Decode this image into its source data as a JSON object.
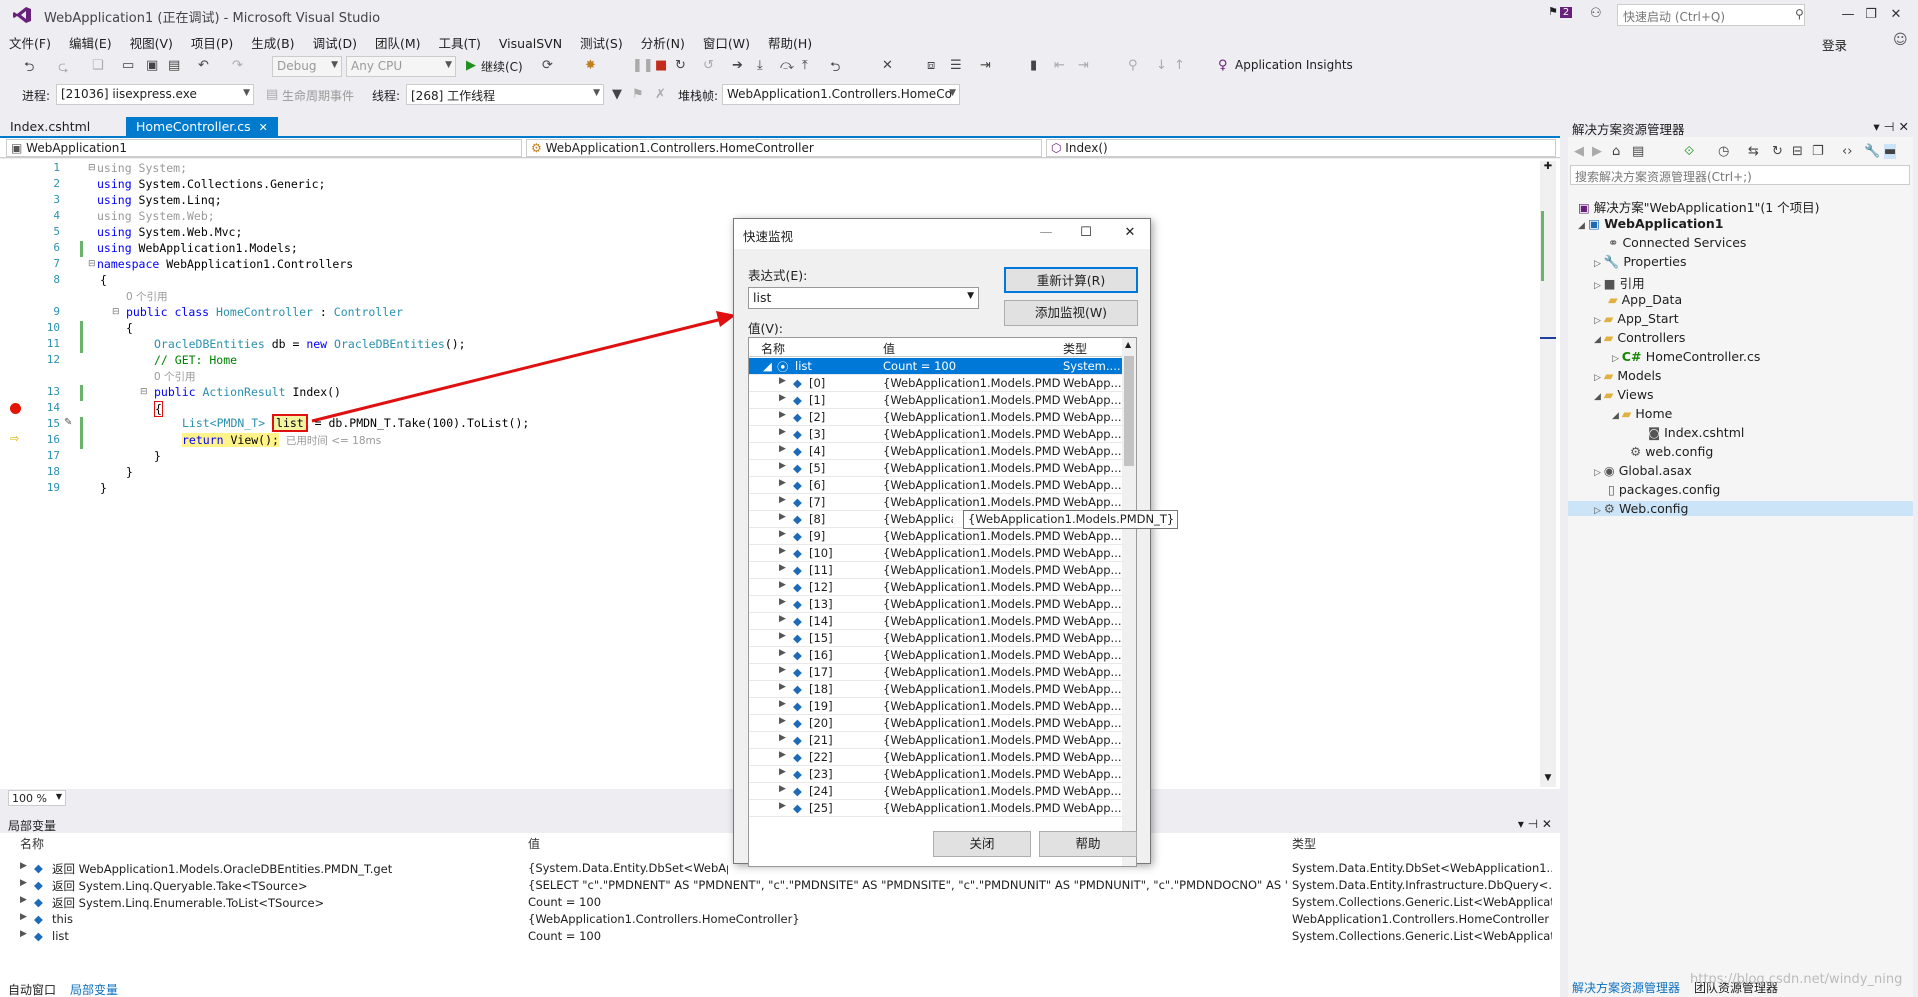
{
  "window": {
    "title": "WebApplication1 (正在调试) - Microsoft Visual Studio",
    "notification_count": "2",
    "quick_launch_placeholder": "快速启动 (Ctrl+Q)",
    "signin": "登录"
  },
  "menu": [
    "文件(F)",
    "编辑(E)",
    "视图(V)",
    "项目(P)",
    "生成(B)",
    "调试(D)",
    "团队(M)",
    "工具(T)",
    "VisualSVN",
    "测试(S)",
    "分析(N)",
    "窗口(W)",
    "帮助(H)"
  ],
  "toolbar": {
    "config": "Debug",
    "platform": "Any CPU",
    "continue_label": "继续(C)",
    "app_insights": "Application Insights"
  },
  "debug_toolbar": {
    "process_label": "进程:",
    "process": "[21036] iisexpress.exe",
    "lifecycle": "生命周期事件",
    "thread_label": "线程:",
    "thread": "[268] 工作线程",
    "stack_label": "堆栈帧:",
    "stack": "WebApplication1.Controllers.HomeCo"
  },
  "tabs": [
    {
      "label": "Index.cshtml"
    },
    {
      "label": "HomeController.cs"
    }
  ],
  "editor_nav": {
    "project": "WebApplication1",
    "class": "WebApplication1.Controllers.HomeController",
    "member": "Index()"
  },
  "code": {
    "line_numbers": [
      "1",
      "2",
      "3",
      "4",
      "5",
      "6",
      "7",
      "8",
      "9",
      "10",
      "11",
      "12",
      "13",
      "14",
      "15",
      "16",
      "17",
      "18",
      "19"
    ],
    "l1_kw": "using",
    "l1_rest": " System;",
    "l2_kw": "using",
    "l2_rest": " System.Collections.Generic;",
    "l3_kw": "using",
    "l3_rest": " System.Linq;",
    "l4_kw": "using",
    "l4_rest": " System.Web;",
    "l5_kw": "using",
    "l5_rest": " System.Web.Mvc;",
    "l6_kw": "using",
    "l6_rest": " WebApplication1.Models;",
    "l7_kw": "namespace",
    "l7_rest": " WebApplication1.Controllers",
    "l8": "{",
    "ref1": "0 个引用",
    "l9_kw1": "public",
    "l9_kw2": "class",
    "l9_type": "HomeController",
    "l9_colon": " : ",
    "l9_base": "Controller",
    "l10": "{",
    "l11_type": "OracleDBEntities",
    "l11_mid": " db = ",
    "l11_kw": "new",
    "l11_type2": "OracleDBEntities",
    "l11_end": "();",
    "l12": "// GET: Home",
    "ref2": "0 个引用",
    "l13_kw": "public",
    "l13_type": "ActionResult",
    "l13_rest": " Index()",
    "l14": "{",
    "l15_type": "List",
    "l15_gen": "<PMDN_T>",
    "l15_var": "list",
    "l15_rest": " = db.PMDN_T.Take(100).ToList();",
    "l16_kw": "return",
    "l16_call": " View();",
    "l16_elapsed": "已用时间 <= 18ms",
    "l17": "}",
    "l18": "}",
    "l19": "}"
  },
  "zoom": "100 %",
  "locals": {
    "title": "局部变量",
    "col_name": "名称",
    "col_value": "值",
    "col_type": "类型",
    "rows": [
      {
        "name": "返回 WebApplication1.Models.OracleDBEntities.PMDN_T.get",
        "value": "{System.Data.Entity.DbSet<WebApplica",
        "type": "System.Data.Entity.DbSet<WebApplication1...."
      },
      {
        "name": "返回 System.Linq.Queryable.Take<TSource>",
        "value": "{SELECT \"c\".\"PMDNENT\" AS \"PMDNENT\", \"c\".\"PMDNSITE\" AS \"PMDNSITE\", \"c\".\"PMDNUNIT\" AS \"PMDNUNIT\", \"c\".\"PMDNDOCNO\" AS \"PMD...",
        "type": "System.Data.Entity.Infrastructure.DbQuery<..."
      },
      {
        "name": "返回 System.Linq.Enumerable.ToList<TSource>",
        "value": "Count = 100",
        "type": "System.Collections.Generic.List<WebApplicat..."
      },
      {
        "name": "this",
        "value": "{WebApplication1.Controllers.HomeController}",
        "type": "WebApplication1.Controllers.HomeController"
      },
      {
        "name": "list",
        "value": "Count = 100",
        "type": "System.Collections.Generic.List<WebApplicat..."
      }
    ],
    "bottom_tab1": "自动窗口",
    "bottom_tab2": "局部变量"
  },
  "solution": {
    "title": "解决方案资源管理器",
    "search_placeholder": "搜索解决方案资源管理器(Ctrl+;)",
    "items": [
      {
        "label": "解决方案\"WebApplication1\"(1 个项目)"
      },
      {
        "label": "WebApplication1"
      },
      {
        "label": "Connected Services"
      },
      {
        "label": "Properties"
      },
      {
        "label": "引用"
      },
      {
        "label": "App_Data"
      },
      {
        "label": "App_Start"
      },
      {
        "label": "Controllers"
      },
      {
        "label": "HomeController.cs"
      },
      {
        "label": "Models"
      },
      {
        "label": "Views"
      },
      {
        "label": "Home"
      },
      {
        "label": "Index.cshtml"
      },
      {
        "label": "web.config"
      },
      {
        "label": "Global.asax"
      },
      {
        "label": "packages.config"
      },
      {
        "label": "Web.config"
      }
    ],
    "bottom_tab1": "解决方案资源管理器",
    "bottom_tab2": "团队资源管理器"
  },
  "quickwatch": {
    "title": "快速监视",
    "expr_label": "表达式(E):",
    "expr_value": "list",
    "recalc": "重新计算(R)",
    "add_watch": "添加监视(W)",
    "value_label": "值(V):",
    "col_name": "名称",
    "col_value": "值",
    "col_type": "类型",
    "root_name": "list",
    "root_value": "Count = 100",
    "root_type": "System....",
    "item_value": "{WebApplication1.Models.PMD...",
    "item_type": "WebApp...",
    "item_value_cut": "{WebApplicati",
    "tooltip": "{WebApplication1.Models.PMDN_T}",
    "items": [
      "[0]",
      "[1]",
      "[2]",
      "[3]",
      "[4]",
      "[5]",
      "[6]",
      "[7]",
      "[8]",
      "[9]",
      "[10]",
      "[11]",
      "[12]",
      "[13]",
      "[14]",
      "[15]",
      "[16]",
      "[17]",
      "[18]",
      "[19]",
      "[20]",
      "[21]",
      "[22]",
      "[23]",
      "[24]",
      "[25]"
    ],
    "close": "关闭",
    "help": "帮助"
  },
  "watermark": "https://blog.csdn.net/windy_ning",
  "colors": {
    "accent": "#007acc",
    "breakpoint": "#e51400",
    "annotation": "#e01010"
  }
}
